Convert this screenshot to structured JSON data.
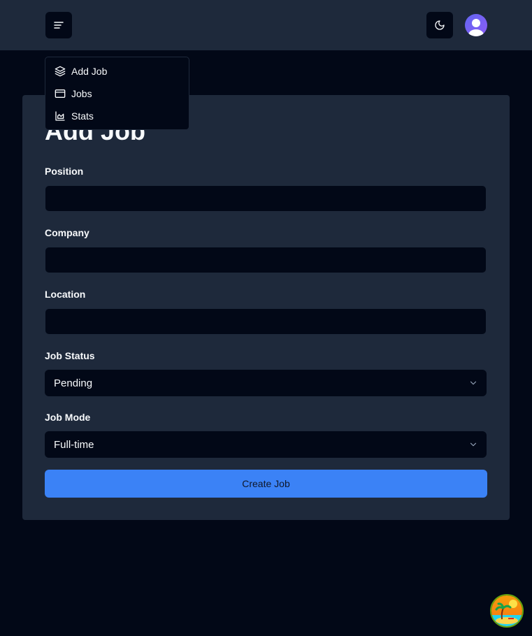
{
  "header": {
    "menu_icon": "menu-icon",
    "theme_icon": "moon-icon",
    "avatar_icon": "user-icon"
  },
  "nav_menu": {
    "items": [
      {
        "label": "Add Job",
        "icon": "layers-icon"
      },
      {
        "label": "Jobs",
        "icon": "app-window-icon"
      },
      {
        "label": "Stats",
        "icon": "area-chart-icon"
      }
    ]
  },
  "form": {
    "title": "Add Job",
    "position": {
      "label": "Position",
      "value": ""
    },
    "company": {
      "label": "Company",
      "value": ""
    },
    "location": {
      "label": "Location",
      "value": ""
    },
    "job_status": {
      "label": "Job Status",
      "selected": "Pending"
    },
    "job_mode": {
      "label": "Job Mode",
      "selected": "Full-time"
    },
    "submit_label": "Create Job"
  },
  "colors": {
    "background": "#020817",
    "header": "#1e293b",
    "card": "#1e293b",
    "primary": "#3b82f6",
    "text": "#f8fafc"
  },
  "floating_widget": {
    "icon": "beach-icon"
  }
}
